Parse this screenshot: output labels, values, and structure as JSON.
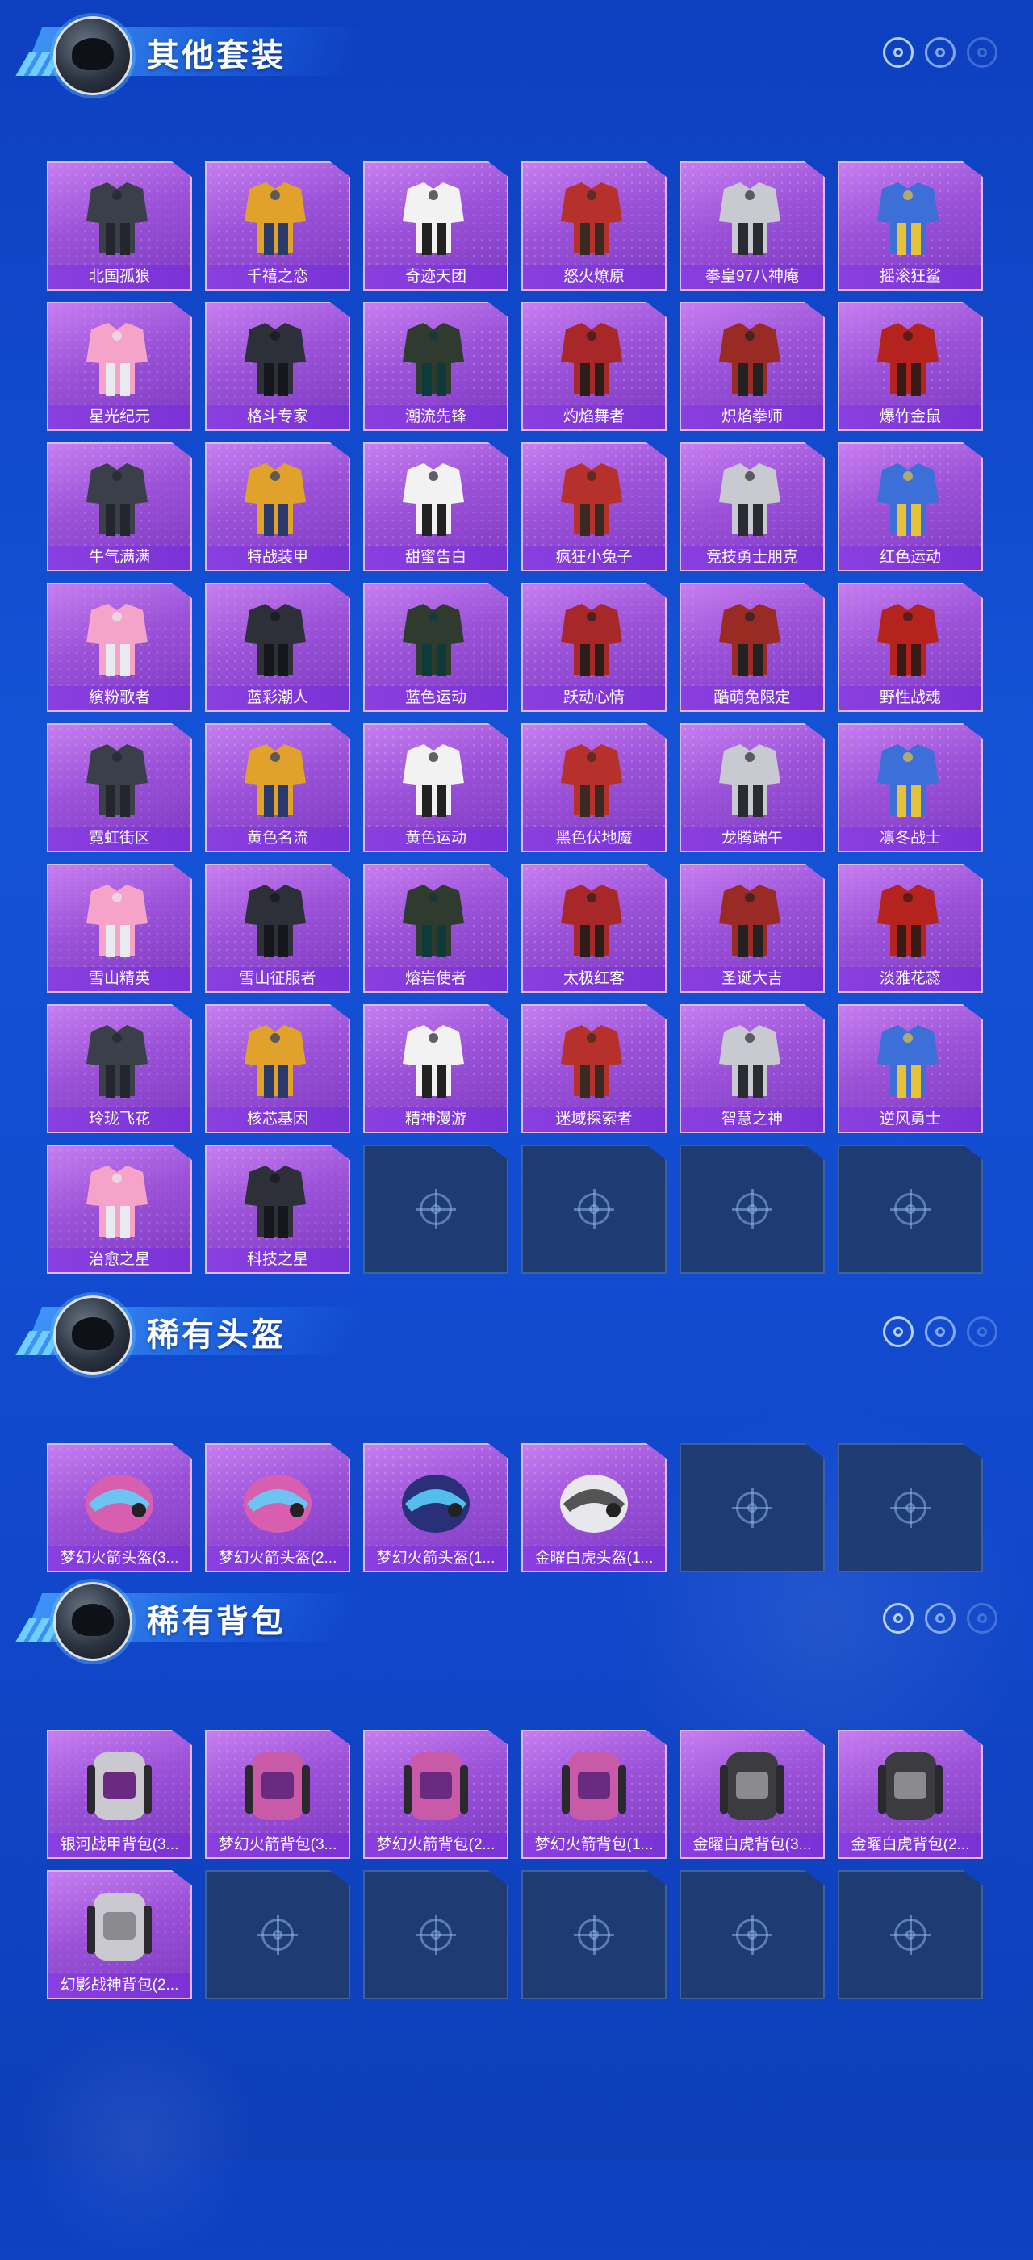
{
  "sections": [
    {
      "title": "其他套装",
      "items": [
        "北国孤狼",
        "千禧之恋",
        "奇迹天团",
        "怒火燎原",
        "拳皇97八神庵",
        "摇滚狂鲨",
        "星光纪元",
        "格斗专家",
        "潮流先锋",
        "灼焰舞者",
        "炽焰拳师",
        "爆竹金鼠",
        "牛气满满",
        "特战装甲",
        "甜蜜告白",
        "疯狂小兔子",
        "竞技勇士朋克",
        "红色运动",
        "繽粉歌者",
        "蓝彩潮人",
        "蓝色运动",
        "跃动心情",
        "酷萌兔限定",
        "野性战魂",
        "霓虹街区",
        "黄色名流",
        "黄色运动",
        "黑色伏地魔",
        "龙腾端午",
        "凛冬战士",
        "雪山精英",
        "雪山征服者",
        "熔岩使者",
        "太极红客",
        "圣诞大吉",
        "淡雅花蕊",
        "玲珑飞花",
        "核芯基因",
        "精神漫游",
        "迷域探索者",
        "智慧之神",
        "逆风勇士",
        "治愈之星",
        "科技之星"
      ],
      "empty_slots": 4
    },
    {
      "title": "稀有头盔",
      "items": [
        "梦幻火箭头盔(3...",
        "梦幻火箭头盔(2...",
        "梦幻火箭头盔(1...",
        "金曜白虎头盔(1..."
      ],
      "empty_slots": 2
    },
    {
      "title": "稀有背包",
      "items": [
        "银河战甲背包(3...",
        "梦幻火箭背包(3...",
        "梦幻火箭背包(2...",
        "梦幻火箭背包(1...",
        "金曜白虎背包(3...",
        "金曜白虎背包(2...",
        "幻影战神背包(2..."
      ],
      "empty_slots": 5
    }
  ],
  "colors": {
    "background": "#1453d6",
    "card": "#9b52d8",
    "label_bar": "#7a32d6",
    "empty": "#1e3c73"
  }
}
